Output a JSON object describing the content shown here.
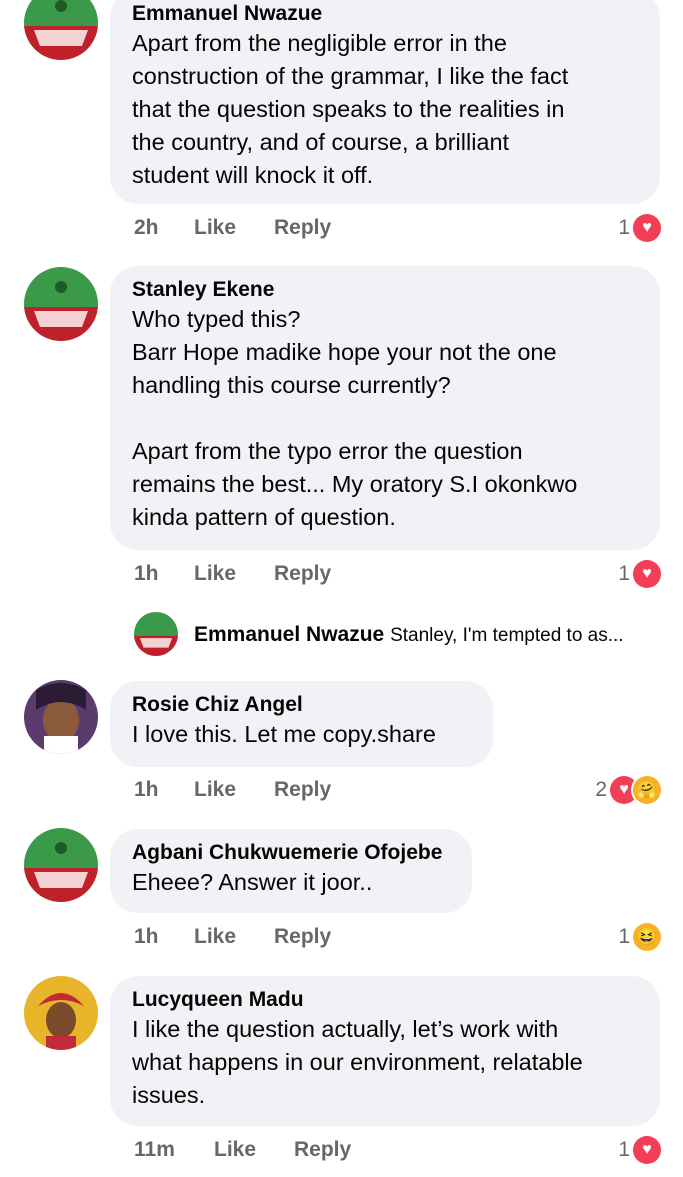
{
  "comments": [
    {
      "author": "Emmanuel Nwazue",
      "text": "Apart from the negligible error in the\nconstruction of the grammar, I like the fact\nthat the question speaks to the realities in\nthe country, and of course, a brilliant\nstudent will knock it off.",
      "time": "2h",
      "like": "Like",
      "reply": "Reply",
      "reactions": "1",
      "reaction_icons": [
        "heart-icon"
      ]
    },
    {
      "author": "Stanley Ekene",
      "text": "Who typed this?\nBarr Hope madike hope your not the one\nhandling this course currently?\n\nApart from the typo error the question\nremains the best... My oratory S.I okonkwo\nkinda pattern of question.",
      "time": "1h",
      "like": "Like",
      "reply": "Reply",
      "reactions": "1",
      "reaction_icons": [
        "heart-icon"
      ]
    },
    {
      "author": "Rosie Chiz Angel",
      "text": "I love this. Let me copy.share",
      "time": "1h",
      "like": "Like",
      "reply": "Reply",
      "reactions": "2",
      "reaction_icons": [
        "heart-icon",
        "care-icon"
      ]
    },
    {
      "author": "Agbani Chukwuemerie Ofojebe",
      "text": "Eheee? Answer it joor..",
      "time": "1h",
      "like": "Like",
      "reply": "Reply",
      "reactions": "1",
      "reaction_icons": [
        "haha-icon"
      ]
    },
    {
      "author": "Lucyqueen Madu",
      "text": "I like the question actually, let’s work with\nwhat happens in our environment, relatable\nissues.",
      "time": "11m",
      "like": "Like",
      "reply": "Reply",
      "reactions": "1",
      "reaction_icons": [
        "heart-icon"
      ]
    }
  ],
  "reply_preview": {
    "author": "Emmanuel Nwazue",
    "snippet": "Stanley, I'm tempted to as..."
  },
  "colors": {
    "bubble": "#f0f2f5",
    "meta": "#65676b",
    "heart": "#f33e58"
  }
}
